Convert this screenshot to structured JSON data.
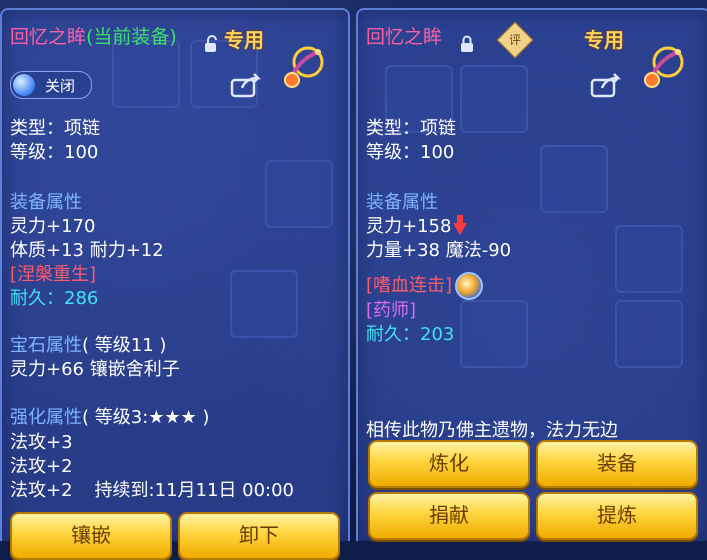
{
  "left": {
    "title": "回忆之眸",
    "status": "(当前装备)",
    "exclusive": "专用",
    "toggle_label": "关闭",
    "type_line": "类型：项链",
    "level_line": "等级：100",
    "equip_attr_title": "装备属性",
    "attr1": "灵力+170",
    "attr2": "体质+13 耐力+12",
    "special": "[涅槃重生]",
    "durability_label": "耐久：",
    "durability_value": "286",
    "gem_title": "宝石属性",
    "gem_level": "( 等级11 )",
    "gem_attr": "灵力+66 镶嵌舍利子",
    "enhance_title": "强化属性",
    "enhance_level": "( 等级3:★★★ )",
    "enh1": "法攻+3",
    "enh2": "法攻+2",
    "enh3": "法攻+2",
    "enh3_duration": "持续到:11月11日 00:00",
    "btn_inlay": "镶嵌",
    "btn_unequip": "卸下"
  },
  "right": {
    "title": "回忆之眸",
    "badge": "评",
    "exclusive": "专用",
    "type_line": "类型：项链",
    "level_line": "等级：100",
    "equip_attr_title": "装备属性",
    "attr1": "灵力+158",
    "attr2": "力量+38 魔法-90",
    "skill": "[嗜血连击]",
    "profession": "[药师]",
    "durability_label": "耐久：",
    "durability_value": "203",
    "description": "相传此物乃佛主遗物，法力无边",
    "btn_refine": "炼化",
    "btn_equip": "装备",
    "btn_donate": "捐献",
    "btn_extract": "提炼"
  },
  "colors": {
    "panel": "#3750af",
    "button": "#ffd43c",
    "title_pink": "#ff5fa0",
    "current_green": "#39e06a",
    "section_blue": "#7fb4ff",
    "special_red": "#ff5b6e",
    "durability_cyan": "#40e0f5",
    "profession_purple": "#d86cf5",
    "exclusive_gold": "#ffd25a"
  },
  "icons": [
    "lock-open-icon",
    "lock-icon",
    "share-icon",
    "dragon-emblem-icon",
    "down-arrow-icon",
    "skill-icon",
    "toggle-switch"
  ]
}
